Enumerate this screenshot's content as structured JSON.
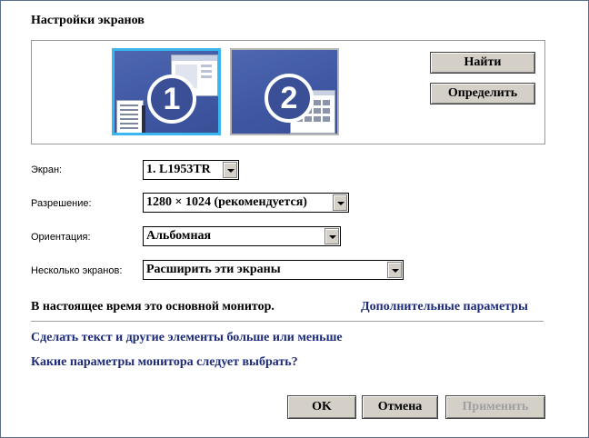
{
  "dialog": {
    "title": "Настройки экранов"
  },
  "preview": {
    "monitors": [
      {
        "number": "1",
        "selected": true
      },
      {
        "number": "2",
        "selected": false
      }
    ]
  },
  "buttons": {
    "find": "Найти",
    "identify": "Определить",
    "ok": "OK",
    "cancel": "Отмена",
    "apply": "Применить"
  },
  "fields": {
    "display": {
      "label": "Экран:",
      "value": "1. L1953TR"
    },
    "resolution": {
      "label": "Разрешение:",
      "value": "1280 × 1024 (рекомендуется)"
    },
    "orientation": {
      "label": "Ориентация:",
      "value": "Альбомная"
    },
    "multiple": {
      "label": "Несколько экранов:",
      "value": "Расширить эти экраны"
    }
  },
  "status": {
    "main_monitor": "В настоящее время это основной монитор."
  },
  "links": {
    "advanced": "Дополнительные параметры",
    "text_size": "Сделать текст и другие элементы больше или меньше",
    "which_settings": "Какие параметры монитора следует выбрать?"
  },
  "colors": {
    "link": "#1c2a78",
    "monitor_bg": "#3f57a3",
    "selected_border": "#39b7ee",
    "button_face": "#d4d0c8",
    "disabled_text": "#a0a0a0"
  }
}
